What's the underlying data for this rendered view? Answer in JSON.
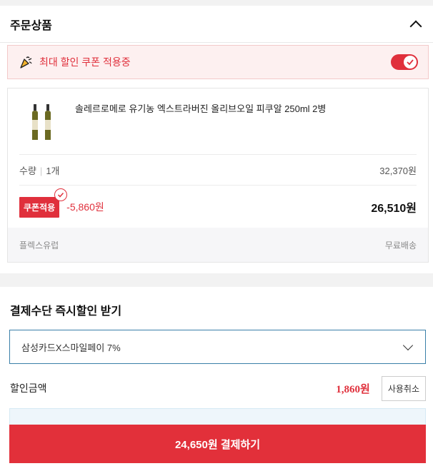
{
  "order": {
    "title": "주문상품",
    "coupon_banner": "최대 할인 쿠폰 적용중",
    "product": {
      "name": "솔레르로메로 유기농 엑스트라버진 올리브오일 피쿠알 250ml 2병",
      "qty_label": "수량",
      "qty_value": "1개",
      "price": "32,370원",
      "coupon_chip": "쿠폰적용",
      "discount": "-5,860원",
      "final_price": "26,510원",
      "seller": "플렉스유럽",
      "shipping": "무료배송"
    }
  },
  "payment": {
    "title": "결제수단 즉시할인 받기",
    "selected_card": "삼성카드X스마일페이 7%",
    "discount_label": "할인금액",
    "discount_amount": "1,860원",
    "cancel_label": "사용취소"
  },
  "pay_button": "24,650원 결제하기",
  "colors": {
    "accent": "#e0303c",
    "select_border": "#3a7fa8"
  }
}
